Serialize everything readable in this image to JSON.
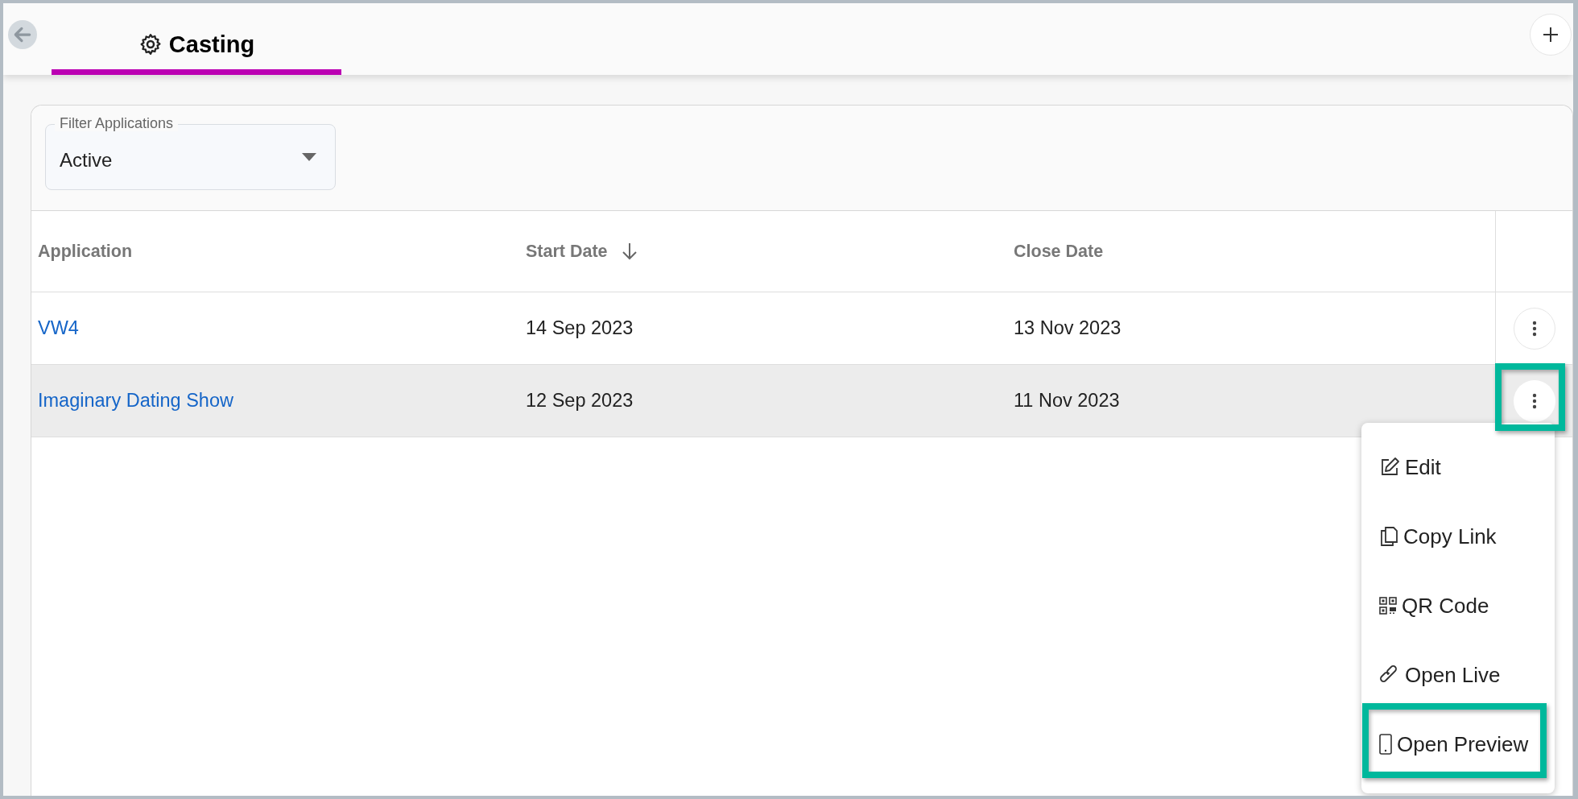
{
  "header": {
    "tabs": [
      {
        "label": "Casting",
        "selected": true
      }
    ]
  },
  "filter": {
    "label": "Filter Applications",
    "value": "Active"
  },
  "table": {
    "columns": [
      {
        "label": "Application",
        "sorted": false
      },
      {
        "label": "Start Date",
        "sorted": true
      },
      {
        "label": "Close Date",
        "sorted": false
      }
    ],
    "rows": [
      {
        "cells": [
          "VW4",
          "14 Sep 2023",
          "13 Nov 2023"
        ],
        "selected": false,
        "highlighted": false
      },
      {
        "cells": [
          "Imaginary Dating Show",
          "12 Sep 2023",
          "11 Nov 2023"
        ],
        "selected": true,
        "highlighted": true
      }
    ]
  },
  "menu": {
    "items": [
      {
        "kind": "edit",
        "label": "Edit",
        "highlighted": false
      },
      {
        "kind": "copy",
        "label": "Copy Link",
        "highlighted": false
      },
      {
        "kind": "qr",
        "label": "QR Code",
        "highlighted": false
      },
      {
        "kind": "link",
        "label": "Open Live",
        "highlighted": false
      },
      {
        "kind": "phone",
        "label": "Open Preview",
        "highlighted": true
      }
    ]
  }
}
